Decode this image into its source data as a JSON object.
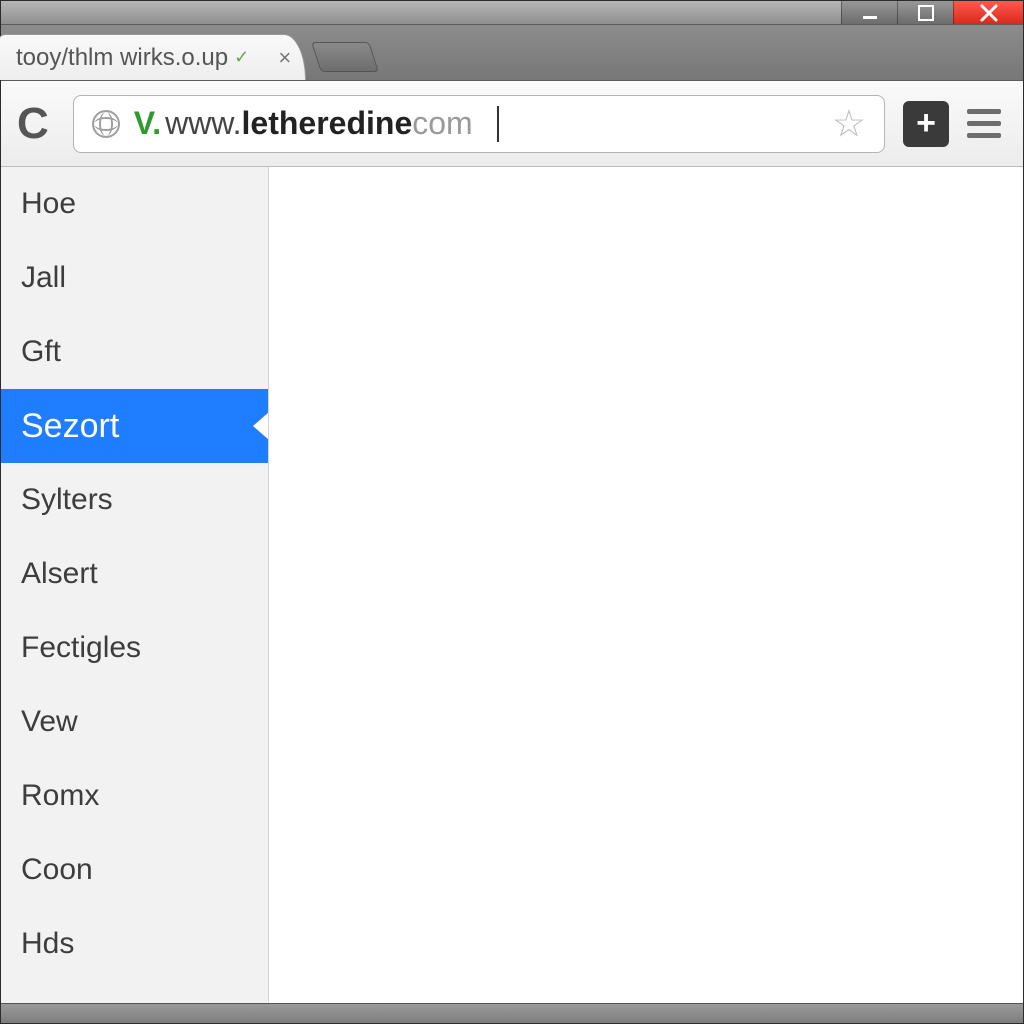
{
  "window": {
    "tab_title": "tooy/thlm wirks.o.up",
    "tab_verified_marker": "✓"
  },
  "omnibox": {
    "secure_prefix": "V.",
    "url_host_prefix": "www.",
    "url_host_bold": "letheredine",
    "url_host_suffix": "com"
  },
  "sidebar": {
    "items": [
      {
        "label": "Hoe",
        "selected": false
      },
      {
        "label": "Jall",
        "selected": false
      },
      {
        "label": "Gft",
        "selected": false
      },
      {
        "label": "Sezort",
        "selected": true
      },
      {
        "label": "Sylters",
        "selected": false
      },
      {
        "label": "Alsert",
        "selected": false
      },
      {
        "label": "Fectigles",
        "selected": false
      },
      {
        "label": "Vew",
        "selected": false
      },
      {
        "label": "Romx",
        "selected": false
      },
      {
        "label": "Coon",
        "selected": false
      },
      {
        "label": "Hds",
        "selected": false
      }
    ]
  }
}
